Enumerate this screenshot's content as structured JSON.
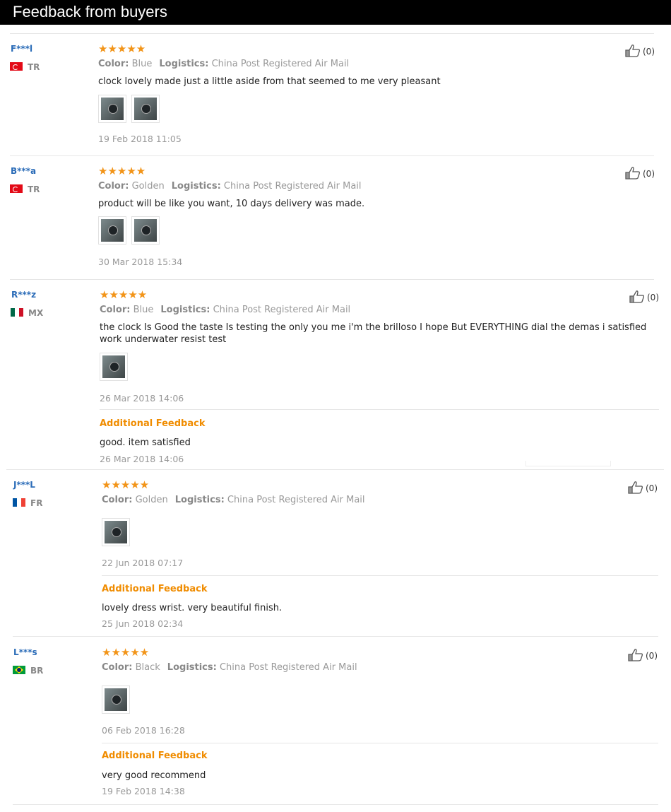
{
  "header": {
    "title": "Feedback from buyers"
  },
  "reviews": [
    {
      "user": "F***l",
      "country": "TR",
      "stars": "★★★★★",
      "color_label": "Color:",
      "color": "Blue",
      "logistics_label": "Logistics:",
      "logistics": "China Post Registered Air Mail",
      "text": "clock lovely made just a little aside from that seemed to me very pleasant",
      "date": "19 Feb 2018 11:05",
      "likes": "(0)"
    },
    {
      "user": "B***a",
      "country": "TR",
      "stars": "★★★★★",
      "color_label": "Color:",
      "color": "Golden",
      "logistics_label": "Logistics:",
      "logistics": "China Post Registered Air Mail",
      "text": "product will be like you want, 10 days delivery was made.",
      "date": "30 Mar 2018 15:34",
      "likes": "(0)"
    },
    {
      "user": "R***z",
      "country": "MX",
      "stars": "★★★★★",
      "color_label": "Color:",
      "color": "Blue",
      "logistics_label": "Logistics:",
      "logistics": "China Post Registered Air Mail",
      "text": "the clock Is Good the taste Is testing the only you me i'm the brilloso I hope But EVERYTHING dial the demas i satisfied work underwater resist test",
      "date": "26 Mar 2018 14:06",
      "additional_label": "Additional Feedback",
      "additional_text": "good. item satisfied",
      "additional_date": "26 Mar 2018 14:06",
      "likes": "(0)"
    },
    {
      "user": "J***L",
      "country": "FR",
      "stars": "★★★★★",
      "color_label": "Color:",
      "color": "Golden",
      "logistics_label": "Logistics:",
      "logistics": "China Post Registered Air Mail",
      "date": "22 Jun 2018 07:17",
      "additional_label": "Additional Feedback",
      "additional_text": "lovely dress wrist. very beautiful finish.",
      "additional_date": "25 Jun 2018 02:34",
      "likes": "(0)"
    },
    {
      "user": "L***s",
      "country": "BR",
      "stars": "★★★★★",
      "color_label": "Color:",
      "color": "Black",
      "logistics_label": "Logistics:",
      "logistics": "China Post Registered Air Mail",
      "date": "06 Feb 2018 16:28",
      "additional_label": "Additional Feedback",
      "additional_text": "very good recommend",
      "additional_date": "19 Feb 2018 14:38",
      "likes": "(0)"
    }
  ],
  "colors": {
    "accent_orange": "#f08c00",
    "star": "#f29418",
    "username_blue": "#2b6cb8"
  },
  "icons": {
    "like": "thumbs-up-icon",
    "photo": "review-photo-thumbnail"
  }
}
